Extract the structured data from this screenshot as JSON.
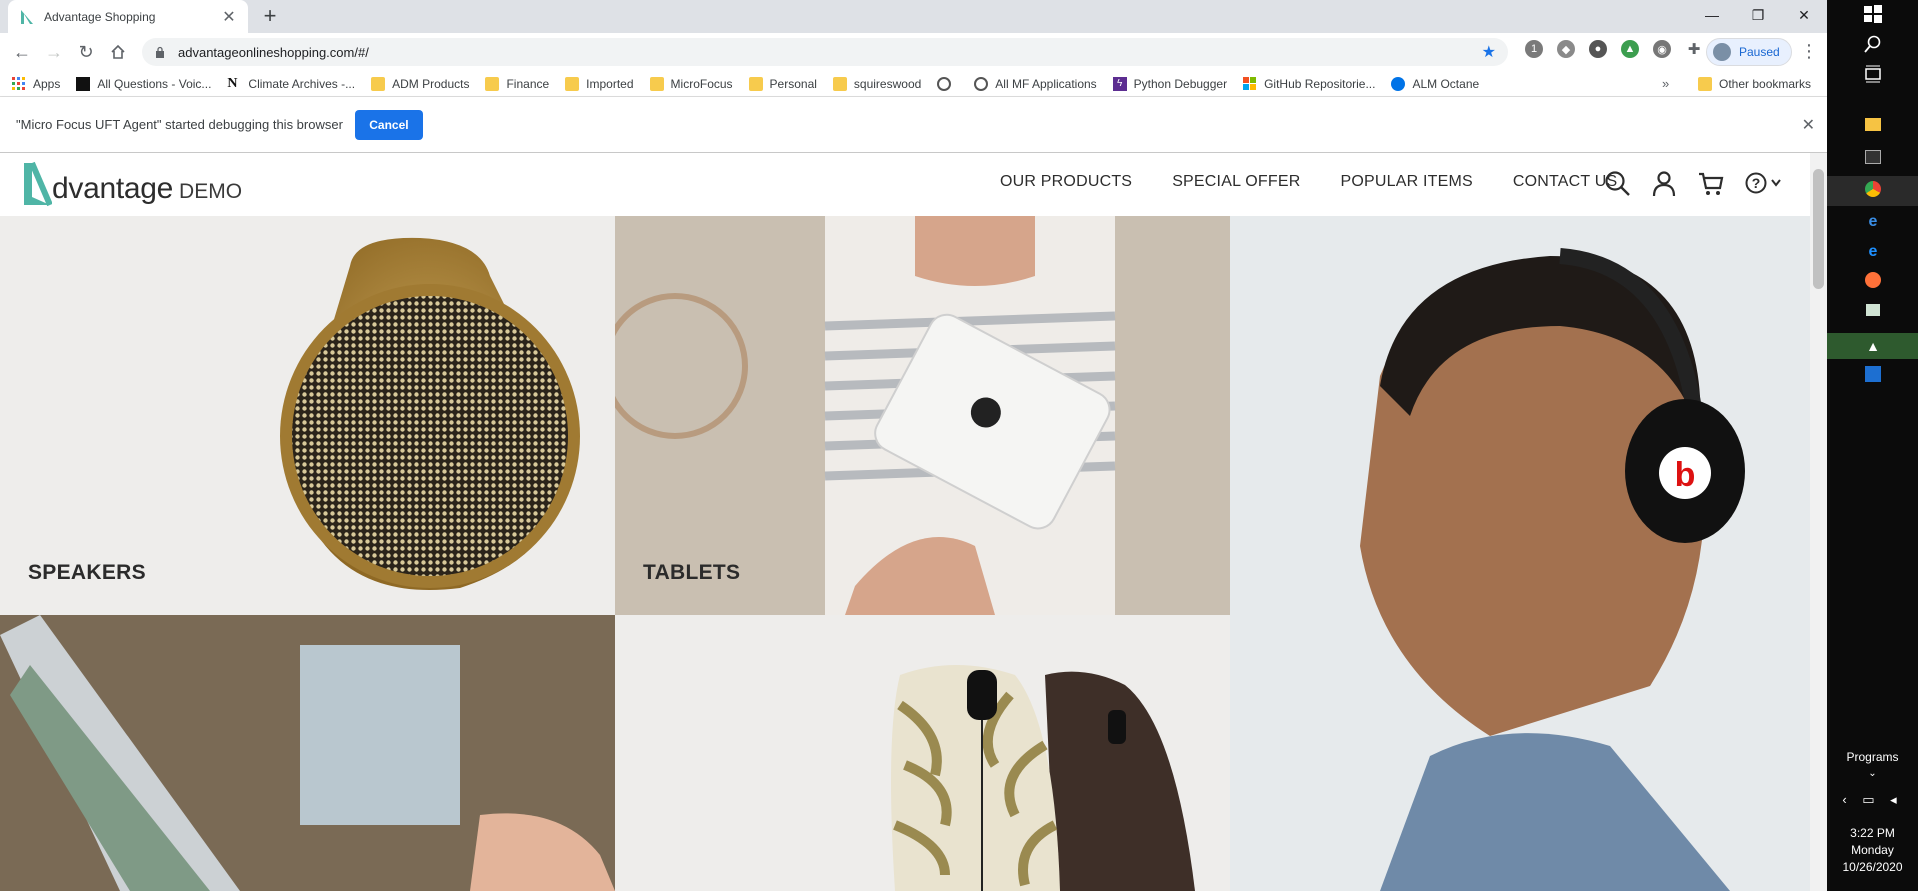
{
  "browser": {
    "tab": {
      "title": "Advantage Shopping"
    },
    "url": "advantageonlineshopping.com/#/",
    "profile_label": "Paused",
    "bookmarks": [
      {
        "label": "Apps",
        "icon": "apps-grid-icon"
      },
      {
        "label": "All Questions - Voic...",
        "icon": "voice-icon"
      },
      {
        "label": "Climate Archives -...",
        "icon": "n-logo-icon"
      },
      {
        "label": "ADM Products",
        "icon": "folder-icon"
      },
      {
        "label": "Finance",
        "icon": "folder-icon"
      },
      {
        "label": "Imported",
        "icon": "folder-icon"
      },
      {
        "label": "MicroFocus",
        "icon": "folder-icon"
      },
      {
        "label": "Personal",
        "icon": "folder-icon"
      },
      {
        "label": "squireswood",
        "icon": "folder-icon"
      },
      {
        "label": "",
        "icon": "globe-icon"
      },
      {
        "label": "All MF Applications",
        "icon": "globe-icon"
      },
      {
        "label": "Python Debugger",
        "icon": "python-debugger-icon"
      },
      {
        "label": "GitHub Repositorie...",
        "icon": "microsoft-logo-icon"
      },
      {
        "label": "ALM Octane",
        "icon": "octane-icon"
      }
    ],
    "bookmarks_more": "»",
    "other_bookmarks": "Other bookmarks",
    "infobar": {
      "message": "\"Micro Focus UFT Agent\" started debugging this browser",
      "cancel_label": "Cancel"
    }
  },
  "site": {
    "logo_word": "dvantage",
    "logo_suffix": "DEMO",
    "nav": [
      "OUR PRODUCTS",
      "SPECIAL OFFER",
      "POPULAR ITEMS",
      "CONTACT US"
    ],
    "categories": [
      {
        "label": "SPEAKERS"
      },
      {
        "label": "TABLETS"
      }
    ]
  },
  "taskbar": {
    "programs_label": "Programs",
    "time": "3:22 PM",
    "day": "Monday",
    "date": "10/26/2020"
  },
  "colors": {
    "brand_teal": "#4fb5a6",
    "chrome_blue": "#1a73e8",
    "tab_strip": "#dee1e6"
  }
}
